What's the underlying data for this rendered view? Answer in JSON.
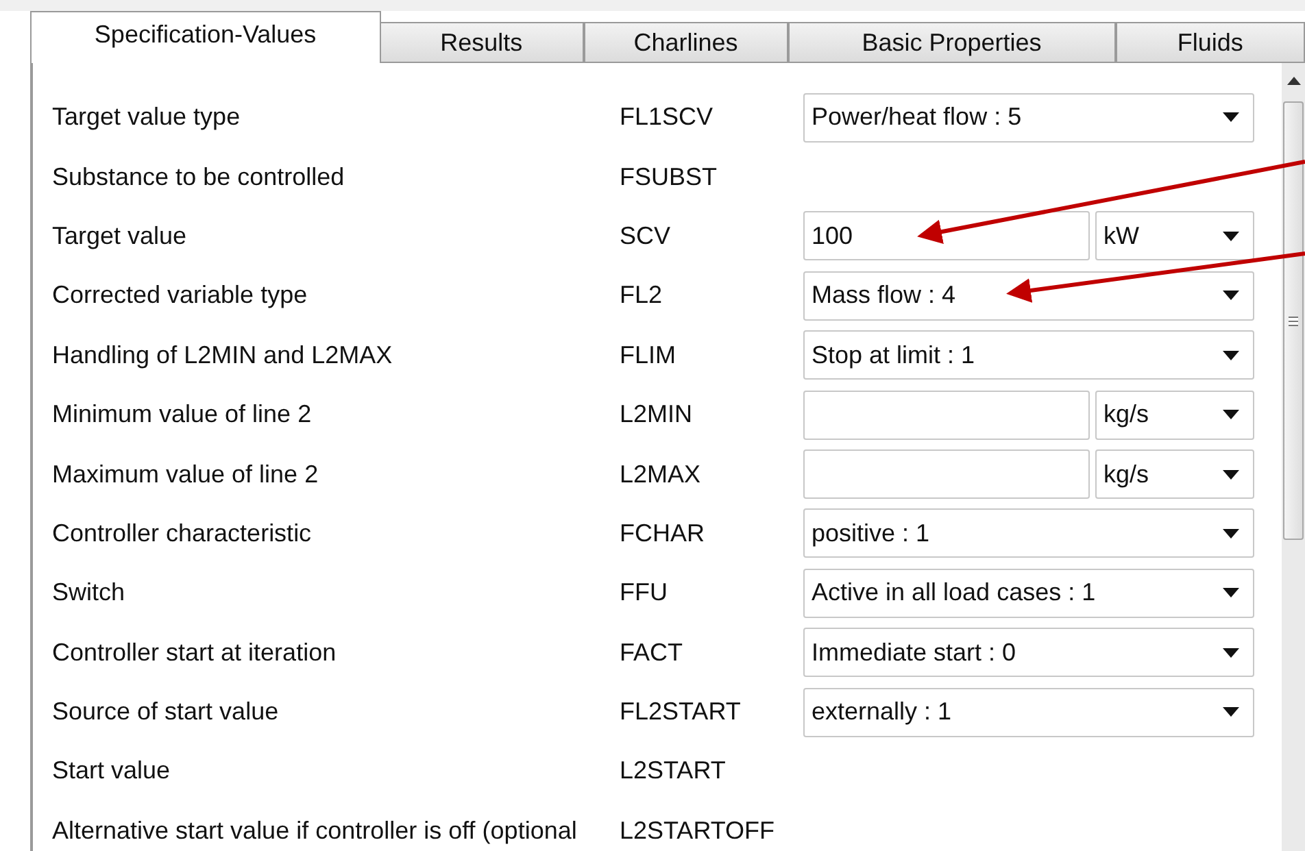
{
  "tabs": [
    {
      "label": "Specification-Values",
      "selected": true
    },
    {
      "label": "Results",
      "selected": false
    },
    {
      "label": "Charlines",
      "selected": false
    },
    {
      "label": "Basic Properties",
      "selected": false
    },
    {
      "label": "Fluids",
      "selected": false
    }
  ],
  "rows": [
    {
      "label": "Target value type",
      "code": "FL1SCV",
      "kind": "select",
      "value": "Power/heat flow : 5"
    },
    {
      "label": "Substance to be controlled",
      "code": "FSUBST",
      "kind": "none"
    },
    {
      "label": "Target value",
      "code": "SCV",
      "kind": "field_unit",
      "value": "100",
      "unit": "kW"
    },
    {
      "label": "Corrected variable type",
      "code": "FL2",
      "kind": "select",
      "value": "Mass flow : 4"
    },
    {
      "label": "Handling of L2MIN and L2MAX",
      "code": "FLIM",
      "kind": "select",
      "value": "Stop at limit : 1"
    },
    {
      "label": "Minimum value of line 2",
      "code": "L2MIN",
      "kind": "field_unit",
      "unit": "kg/s"
    },
    {
      "label": "Maximum value of line 2",
      "code": "L2MAX",
      "kind": "field_unit",
      "unit": "kg/s"
    },
    {
      "label": "Controller characteristic",
      "code": "FCHAR",
      "kind": "select",
      "value": "positive : 1"
    },
    {
      "label": "Switch",
      "code": "FFU",
      "kind": "select",
      "value": "Active in all load cases : 1"
    },
    {
      "label": "Controller start at iteration",
      "code": "FACT",
      "kind": "select",
      "value": "Immediate start : 0"
    },
    {
      "label": "Source of start value",
      "code": "FL2START",
      "kind": "select",
      "value": "externally : 1"
    },
    {
      "label": "Start value",
      "code": "L2START",
      "kind": "none"
    },
    {
      "label": "Alternative start value if controller is off (optional",
      "code": "L2STARTOFF",
      "kind": "none"
    }
  ]
}
